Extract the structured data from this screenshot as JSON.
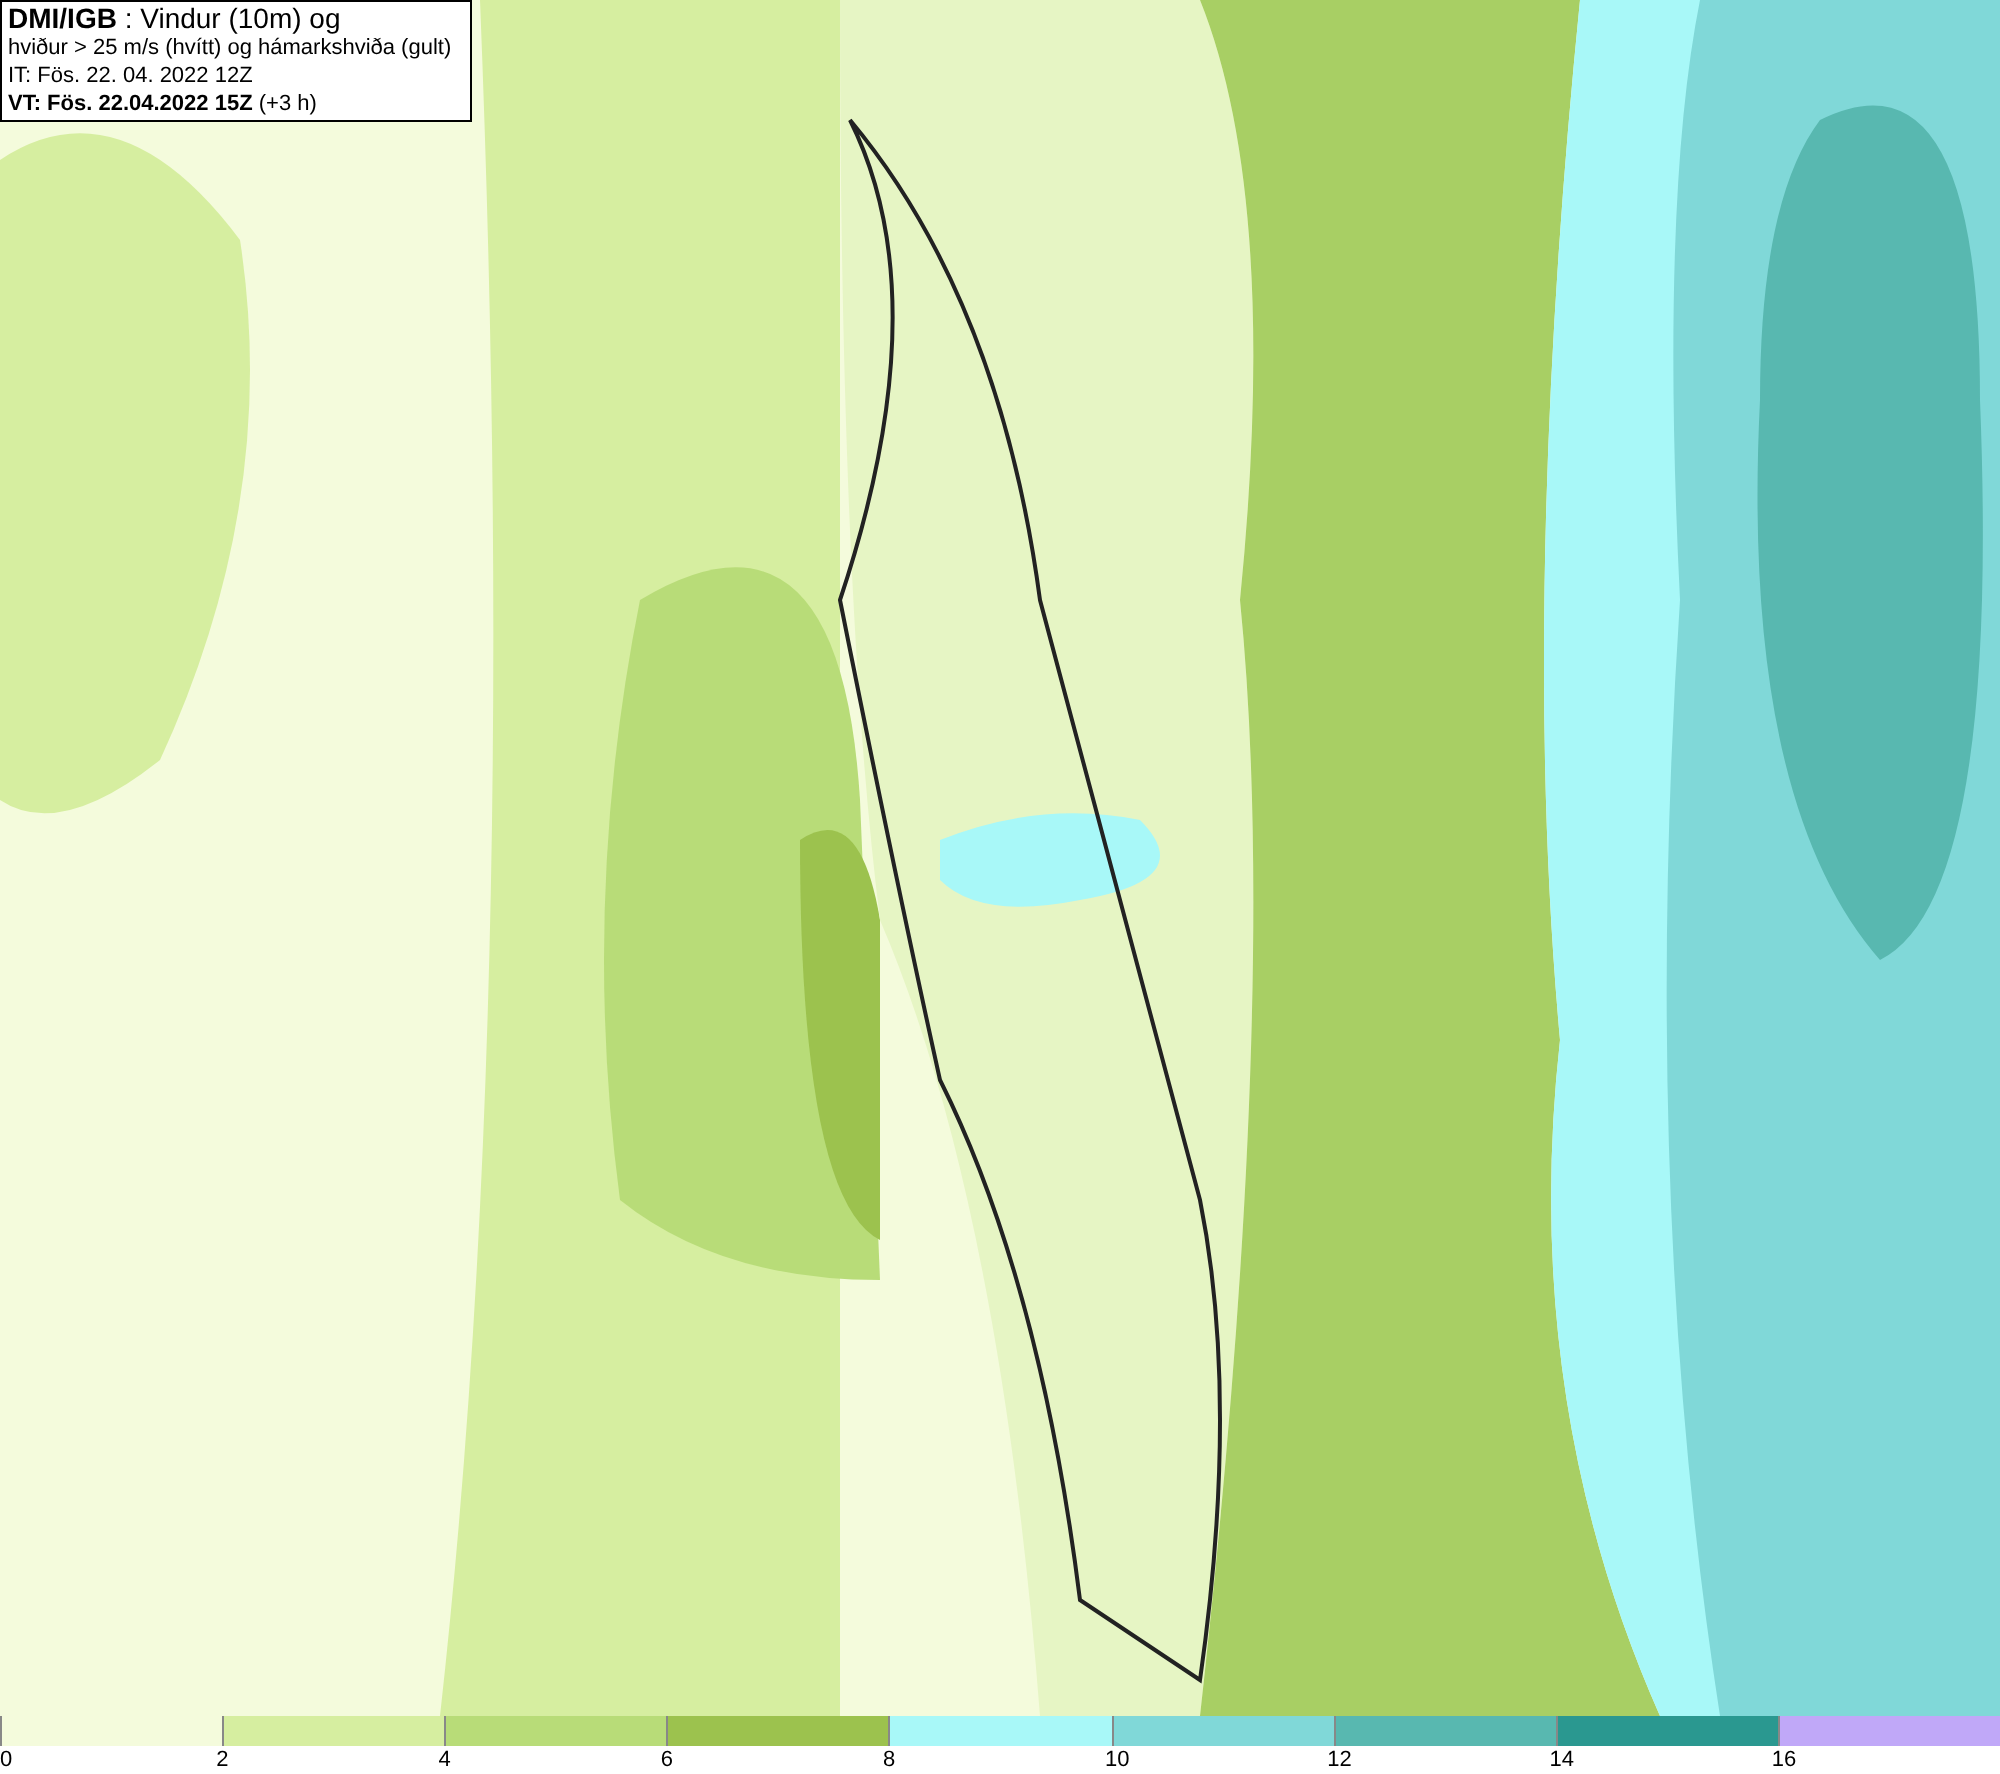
{
  "info_box": {
    "lines": [
      "**DMI/IGB** : Vindur (10m) og",
      "hviður > 25 m/s (hvítt) og hámarkshviða (gult)",
      "IT: Fös. 22. 04. 2022 12Z",
      "**VT: Fös. 22.04.2022 15Z** (+3 h)"
    ]
  },
  "legend": [
    {
      "label": "0",
      "color": "#f4fbdc"
    },
    {
      "label": "2",
      "color": "#d6eea0"
    },
    {
      "label": "4",
      "color": "#b8dc78"
    },
    {
      "label": "6",
      "color": "#9cc24e"
    },
    {
      "label": "8",
      "color": "#a8f8f8"
    },
    {
      "label": "10",
      "color": "#80d8d8"
    },
    {
      "label": "12",
      "color": "#58b8b0"
    },
    {
      "label": "14",
      "color": "#2a9890"
    },
    {
      "label": "16",
      "color": "#c0a8f8"
    }
  ]
}
